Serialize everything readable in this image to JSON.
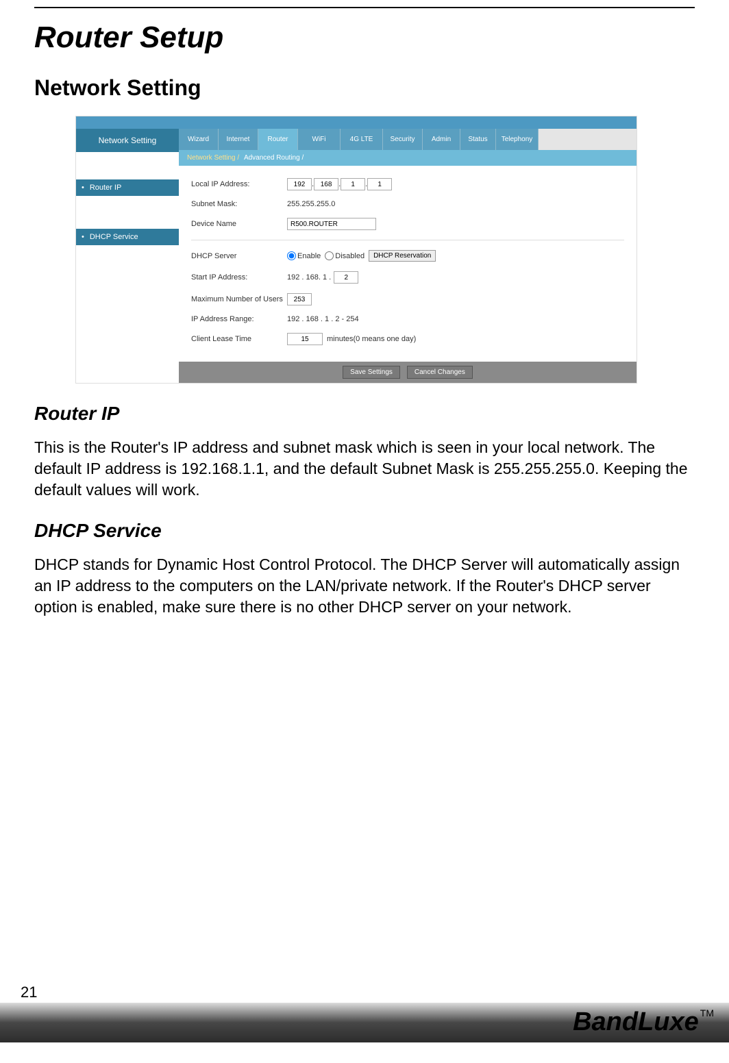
{
  "page": {
    "number": "21",
    "title": "Router Setup",
    "section_heading": "Network Setting",
    "brand": "BandLuxe",
    "brand_tm": "TM"
  },
  "screenshot": {
    "left_nav": {
      "main": "Network Setting",
      "sub1": "Router IP",
      "sub2": "DHCP Service"
    },
    "tabs": [
      "Wizard",
      "Internet",
      "Router",
      "WiFi",
      "4G LTE",
      "Security",
      "Admin",
      "Status",
      "Telephony"
    ],
    "subtabs": {
      "active": "Network Setting /",
      "other": "Advanced Routing /"
    },
    "router_ip": {
      "label_localip": "Local IP Address:",
      "ip": [
        "192",
        "168",
        "1",
        "1"
      ],
      "label_subnet": "Subnet Mask:",
      "subnet": "255.255.255.0",
      "label_device": "Device Name",
      "device": "R500.ROUTER"
    },
    "dhcp": {
      "label_server": "DHCP Server",
      "opt_enable": "Enable",
      "opt_disabled": "Disabled",
      "btn_reservation": "DHCP Reservation",
      "label_startip": "Start IP Address:",
      "startip_prefix": "192 . 168. 1 .",
      "startip_last": "2",
      "label_maxusers": "Maximum Number of Users",
      "maxusers": "253",
      "label_range": "IP Address Range:",
      "range": "192 . 168 . 1 . 2 - 254",
      "label_lease": "Client Lease Time",
      "lease": "15",
      "lease_suffix": "minutes(0 means one day)"
    },
    "buttons": {
      "save": "Save Settings",
      "cancel": "Cancel Changes"
    }
  },
  "content": {
    "h_routerip": "Router IP",
    "p_routerip": "This is the Router's IP address and subnet mask which is seen in your local network. The default IP address is 192.168.1.1, and the default Subnet Mask is 255.255.255.0. Keeping the default values will work.",
    "h_dhcp": "DHCP Service",
    "p_dhcp": "DHCP stands for Dynamic Host Control Protocol. The DHCP Server will automatically assign an IP address to the computers on the LAN/private network. If the Router's DHCP server option is enabled, make sure there is no other DHCP server on your network."
  }
}
